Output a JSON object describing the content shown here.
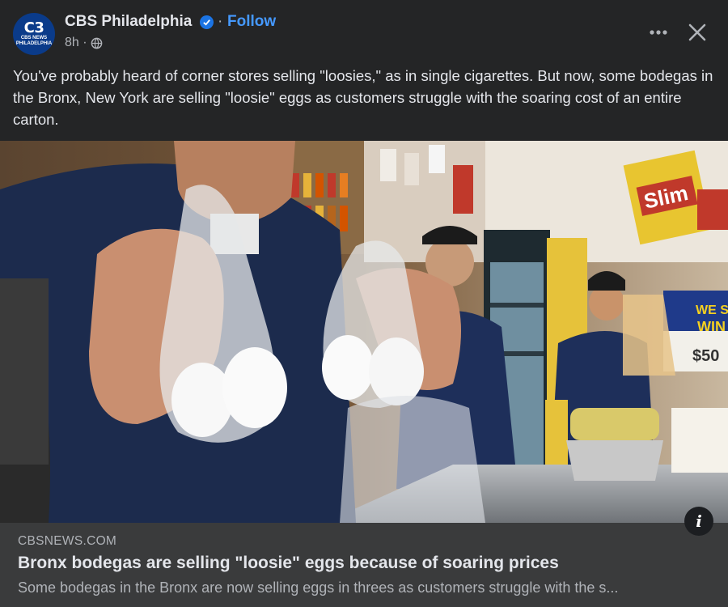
{
  "header": {
    "avatar_logo": "C3",
    "avatar_sub": "CBS NEWS PHILADELPHIA",
    "page_name": "CBS Philadelphia",
    "separator": "·",
    "follow_label": "Follow",
    "time": "8h ·"
  },
  "post": {
    "text": "You've probably heard of corner stores selling \"loosies,\" as in single cigarettes. But now, some bodegas in the Bronx, New York are selling \"loosie\" eggs as customers struggle with the soaring cost of an entire carton."
  },
  "media": {
    "sign_slim": "Slim",
    "sign_we": "WE S",
    "sign_win": "WIN",
    "sign_price": "$50"
  },
  "link": {
    "domain": "CBSNEWS.COM",
    "title": "Bronx bodegas are selling \"loosie\" eggs because of soaring prices",
    "description": "Some bodegas in the Bronx are now selling eggs in threes as customers struggle with the s..."
  },
  "colors": {
    "background": "#242526",
    "accent": "#4599ff",
    "verified": "#1b74e4",
    "preview_bg": "#3a3b3c"
  }
}
